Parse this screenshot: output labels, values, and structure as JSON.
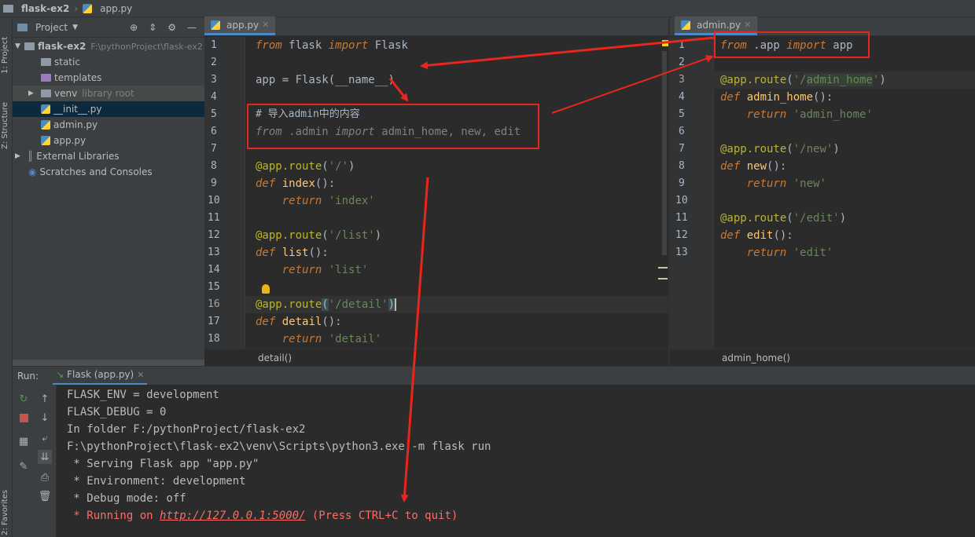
{
  "breadcrumb": {
    "project": "flask-ex2",
    "file": "app.py"
  },
  "side_tabs": {
    "project": "1: Project",
    "structure": "Z: Structure",
    "favorites": "2: Favorites"
  },
  "project_panel": {
    "title": "Project",
    "root": {
      "name": "flask-ex2",
      "path": "F:\\pythonProject\\flask-ex2"
    },
    "items": [
      {
        "label": "static"
      },
      {
        "label": "templates"
      },
      {
        "label": "venv",
        "hint": "library root"
      },
      {
        "label": "__init__.py"
      },
      {
        "label": "admin.py"
      },
      {
        "label": "app.py"
      },
      {
        "label": "External Libraries"
      },
      {
        "label": "Scratches and Consoles"
      }
    ]
  },
  "left_editor": {
    "tab": "app.py",
    "breadcrumb": "detail()",
    "line_numbers": [
      "1",
      "2",
      "3",
      "4",
      "5",
      "6",
      "7",
      "8",
      "9",
      "10",
      "11",
      "12",
      "13",
      "14",
      "15",
      "16",
      "17",
      "18"
    ],
    "comment": "# 导入admin中的内容",
    "import_line": [
      "from",
      " .admin ",
      "import",
      " admin_home, new, edit"
    ]
  },
  "right_editor": {
    "tab": "admin.py",
    "breadcrumb": "admin_home()",
    "line_numbers": [
      "1",
      "2",
      "3",
      "4",
      "5",
      "6",
      "7",
      "8",
      "9",
      "10",
      "11",
      "12",
      "13"
    ]
  },
  "run_panel": {
    "label": "Run:",
    "tab": "Flask (app.py)",
    "lines": [
      "FLASK_ENV = development",
      "FLASK_DEBUG = 0",
      "In folder F:/pythonProject/flask-ex2",
      "F:\\pythonProject\\flask-ex2\\venv\\Scripts\\python3.exe -m flask run",
      " * Serving Flask app \"app.py\"",
      " * Environment: development",
      " * Debug mode: off"
    ],
    "running_prefix": " * Running on ",
    "running_url": "http://127.0.0.1:5000/",
    "running_suffix": " (Press CTRL+C to quit)"
  },
  "colors": {
    "annotation": "#e8261c",
    "keyword": "#cc7832",
    "string": "#6a8759",
    "decorator": "#bbb529",
    "function": "#ffc66d"
  }
}
